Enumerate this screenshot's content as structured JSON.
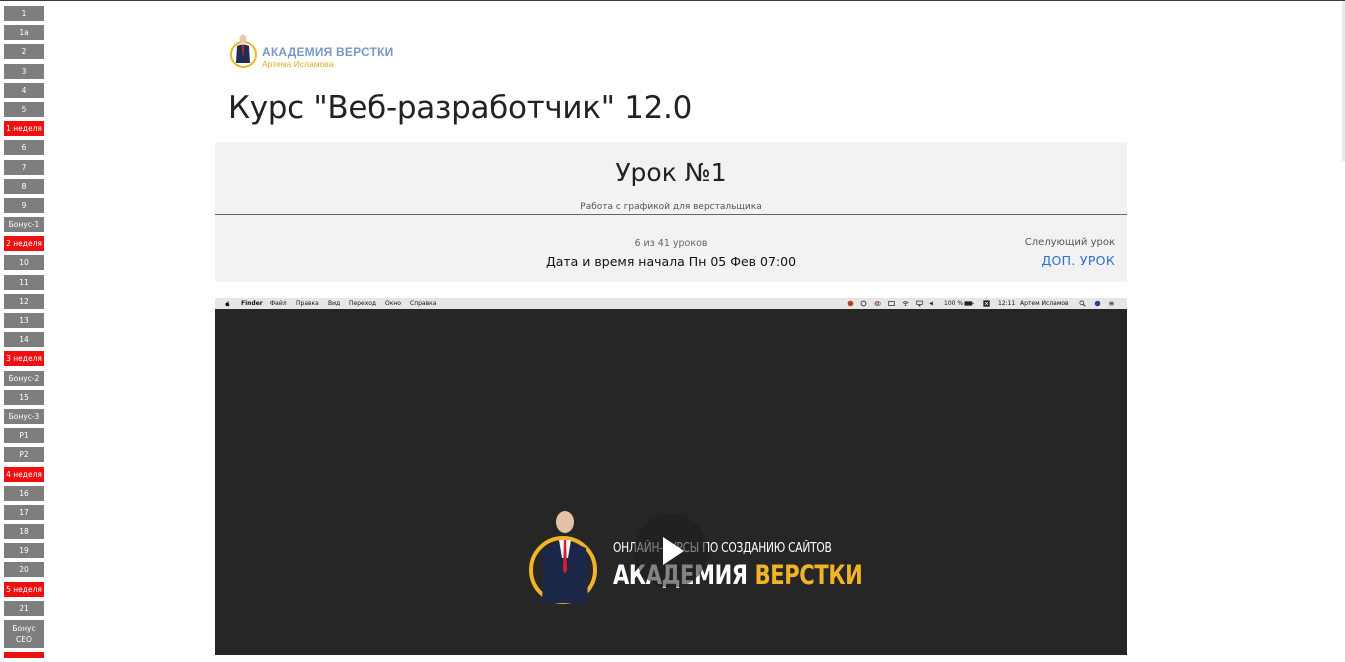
{
  "nav": {
    "items": [
      {
        "label": "1",
        "type": "lesson"
      },
      {
        "label": "1a",
        "type": "lesson"
      },
      {
        "label": "2",
        "type": "lesson"
      },
      {
        "label": "3",
        "type": "lesson"
      },
      {
        "label": "4",
        "type": "lesson"
      },
      {
        "label": "5",
        "type": "lesson"
      },
      {
        "label": "1 неделя",
        "type": "week"
      },
      {
        "label": "6",
        "type": "lesson"
      },
      {
        "label": "7",
        "type": "lesson"
      },
      {
        "label": "8",
        "type": "lesson"
      },
      {
        "label": "9",
        "type": "lesson"
      },
      {
        "label": "Бонус-1",
        "type": "lesson"
      },
      {
        "label": "2 неделя",
        "type": "week"
      },
      {
        "label": "10",
        "type": "lesson"
      },
      {
        "label": "11",
        "type": "lesson"
      },
      {
        "label": "12",
        "type": "lesson"
      },
      {
        "label": "13",
        "type": "lesson"
      },
      {
        "label": "14",
        "type": "lesson"
      },
      {
        "label": "3 неделя",
        "type": "week"
      },
      {
        "label": "Бонус-2",
        "type": "lesson"
      },
      {
        "label": "15",
        "type": "lesson"
      },
      {
        "label": "Бонус-3",
        "type": "lesson"
      },
      {
        "label": "P1",
        "type": "lesson"
      },
      {
        "label": "P2",
        "type": "lesson"
      },
      {
        "label": "4 неделя",
        "type": "week"
      },
      {
        "label": "16",
        "type": "lesson"
      },
      {
        "label": "17",
        "type": "lesson"
      },
      {
        "label": "18",
        "type": "lesson"
      },
      {
        "label": "19",
        "type": "lesson"
      },
      {
        "label": "20",
        "type": "lesson"
      },
      {
        "label": "5 неделя",
        "type": "week"
      },
      {
        "label": "21",
        "type": "lesson"
      },
      {
        "label": "Бонус СЕО",
        "type": "tall"
      }
    ],
    "colors": {
      "lesson": "#7e7e7e",
      "week": "#ee1111"
    }
  },
  "logo": {
    "title": "АКАДЕМИЯ ВЕРСТКИ",
    "subtitle": "Артема Исламова"
  },
  "course": {
    "title": "Курс \"Веб-разработчик\" 12.0"
  },
  "lesson": {
    "title": "Урок №1",
    "subtitle": "Работа с графикой для верстальщика",
    "progress": "6 из 41 уроков",
    "start": "Дата и время начала Пн 05 Фев 07:00",
    "next_label": "Слелующий урок",
    "next_link": "ДОП. УРОК"
  },
  "video": {
    "menubar": {
      "app": "Finder",
      "menus": [
        "Файл",
        "Правка",
        "Вид",
        "Переход",
        "Окно",
        "Справка"
      ],
      "battery": "100 %",
      "time": "12:11",
      "user": "Артем Исламов"
    },
    "tagline": "ОНЛАЙН-КУРСЫ ПО СОЗДАНИЮ САЙТОВ",
    "brand_white": "АКАДЕМИЯ ",
    "brand_yellow": "ВЕРСТКИ",
    "accent": "#f0b429"
  }
}
